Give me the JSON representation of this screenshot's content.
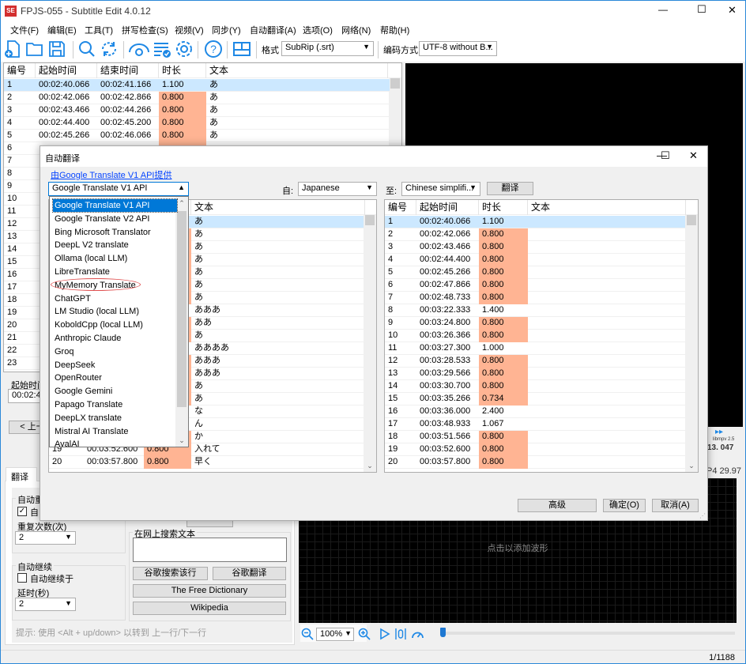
{
  "window": {
    "title": "FPJS-055 - Subtitle Edit 4.0.12",
    "app_icon_text": "SE",
    "minimize": "—",
    "maximize": "☐",
    "close": "✕"
  },
  "menu": [
    "文件(F)",
    "编辑(E)",
    "工具(T)",
    "拼写检查(S)",
    "视频(V)",
    "同步(Y)",
    "自动翻译(A)",
    "选项(O)",
    "网络(N)",
    "帮助(H)"
  ],
  "toolbar": {
    "icons": [
      "new-file-icon",
      "open-folder-icon",
      "save-icon",
      "find-icon",
      "replace-icon",
      "visual-sync-icon",
      "spell-check-icon",
      "settings-icon",
      "help-icon",
      "layout-icon"
    ],
    "format_label": "格式",
    "format_value": "SubRip (.srt)",
    "encoding_label": "编码方式",
    "encoding_value": "UTF-8 without B..."
  },
  "main_grid": {
    "headers": [
      "编号",
      "起始时间",
      "结束时间",
      "时长",
      "文本"
    ],
    "rows": [
      {
        "num": "1",
        "start": "00:02:40.066",
        "end": "00:02:41.166",
        "dur": "1.100",
        "text": "あ"
      },
      {
        "num": "2",
        "start": "00:02:42.066",
        "end": "00:02:42.866",
        "dur": "0.800",
        "text": "あ"
      },
      {
        "num": "3",
        "start": "00:02:43.466",
        "end": "00:02:44.266",
        "dur": "0.800",
        "text": "あ"
      },
      {
        "num": "4",
        "start": "00:02:44.400",
        "end": "00:02:45.200",
        "dur": "0.800",
        "text": "あ"
      },
      {
        "num": "5",
        "start": "00:02:45.266",
        "end": "00:02:46.066",
        "dur": "0.800",
        "text": "あ"
      },
      {
        "num": "6"
      },
      {
        "num": "7"
      },
      {
        "num": "8"
      },
      {
        "num": "9"
      },
      {
        "num": "10"
      },
      {
        "num": "11"
      },
      {
        "num": "12"
      },
      {
        "num": "13"
      },
      {
        "num": "14"
      },
      {
        "num": "15"
      },
      {
        "num": "16"
      },
      {
        "num": "17"
      },
      {
        "num": "18"
      },
      {
        "num": "19"
      },
      {
        "num": "20"
      },
      {
        "num": "21"
      },
      {
        "num": "22"
      },
      {
        "num": "23"
      }
    ]
  },
  "edit_panel": {
    "start_label": "起始时间",
    "start_value": "00:02:40",
    "prev_button": "< 上一"
  },
  "bottom_panel": {
    "tab": "翻译",
    "auto_repeat_label": "自动重",
    "auto_repeat_checkbox": "自",
    "repeat_count_label": "重复次数(次)",
    "repeat_count_value": "2",
    "auto_continue_label": "自动继续",
    "auto_continue_checkbox": "自动继续于",
    "delay_label": "延时(秒)",
    "delay_value": "2",
    "search_group_label": "在网上搜索文本",
    "search_text": "",
    "google_search_button": "谷歌搜索该行",
    "google_translate_button": "谷歌翻译",
    "free_dictionary_button": "The Free Dictionary",
    "wikipedia_button": "Wikipedia",
    "hint": "提示: 使用 <Alt + up/down> 以转到 上一行/下一行"
  },
  "video": {
    "player_info": "libmpv 2.5",
    "time": "13. 047",
    "format_info": "P4 29.97"
  },
  "waveform": {
    "placeholder": "点击以添加波形",
    "zoom_value": "100%"
  },
  "status": {
    "position": "1/1188"
  },
  "dialog": {
    "title": "自动翻译",
    "powered_by_link": "由Google Translate V1 API提供",
    "engine_value": "Google Translate V1 API",
    "engines": [
      "Google Translate V1 API",
      "Google Translate V2 API",
      "Bing Microsoft Translator",
      "DeepL V2 translate",
      "Ollama (local LLM)",
      "LibreTranslate",
      "MyMemory Translate",
      "ChatGPT",
      "LM Studio (local LLM)",
      "KoboldCpp (local LLM)",
      "Anthropic Claude",
      "Groq",
      "DeepSeek",
      "OpenRouter",
      "Google Gemini",
      "Papago Translate",
      "DeepLX translate",
      "Mistral AI Translate",
      "AvalAI"
    ],
    "highlighted_engine": "MyMemory Translate",
    "annotation_color": "#e05050",
    "from_label": "自:",
    "from_value": "Japanese",
    "to_label": "至:",
    "to_value": "Chinese simplifi...",
    "translate_button": "翻译",
    "source_headers": [
      "文本"
    ],
    "target_headers": [
      "编号",
      "起始时间",
      "时长",
      "文本"
    ],
    "rows": [
      {
        "num": "1",
        "start": "00:02:40.066",
        "dur": "1.100",
        "text": "あ"
      },
      {
        "num": "2",
        "start": "00:02:42.066",
        "dur": "0.800",
        "text": "あ"
      },
      {
        "num": "3",
        "start": "00:02:43.466",
        "dur": "0.800",
        "text": "あ"
      },
      {
        "num": "4",
        "start": "00:02:44.400",
        "dur": "0.800",
        "text": "あ"
      },
      {
        "num": "5",
        "start": "00:02:45.266",
        "dur": "0.800",
        "text": "あ"
      },
      {
        "num": "6",
        "start": "00:02:47.866",
        "dur": "0.800",
        "text": "あ"
      },
      {
        "num": "7",
        "start": "00:02:48.733",
        "dur": "0.800",
        "text": "あ"
      },
      {
        "num": "8",
        "start": "00:03:22.333",
        "dur": "1.400",
        "text": "あああ"
      },
      {
        "num": "9",
        "start": "00:03:24.800",
        "dur": "0.800",
        "text": "ああ"
      },
      {
        "num": "10",
        "start": "00:03:26.366",
        "dur": "0.800",
        "text": "あ"
      },
      {
        "num": "11",
        "start": "00:03:27.300",
        "dur": "1.000",
        "text": "ああああ"
      },
      {
        "num": "12",
        "start": "00:03:28.533",
        "dur": "0.800",
        "text": "あああ"
      },
      {
        "num": "13",
        "start": "00:03:29.566",
        "dur": "0.800",
        "text": "あああ"
      },
      {
        "num": "14",
        "start": "00:03:30.700",
        "dur": "0.800",
        "text": "あ"
      },
      {
        "num": "15",
        "start": "00:03:35.266",
        "dur": "0.734",
        "text": "あ"
      },
      {
        "num": "16",
        "start": "00:03:36.000",
        "dur": "2.400",
        "text": "な"
      },
      {
        "num": "17",
        "start": "00:03:48.933",
        "dur": "1.067",
        "text": "ん"
      },
      {
        "num": "18",
        "start": "00:03:51.566",
        "dur": "0.800",
        "text": "か"
      },
      {
        "num": "19",
        "start": "00:03:52.600",
        "dur": "0.800",
        "text": "入れて"
      },
      {
        "num": "20",
        "start": "00:03:57.800",
        "dur": "0.800",
        "text": "早く"
      }
    ],
    "advanced_button": "高级",
    "ok_button": "确定(O)",
    "cancel_button": "取消(A)"
  },
  "colors": {
    "accent": "#0078d7",
    "short_duration": "#ffb493",
    "selected_row": "#cce8ff",
    "link": "#0645ff"
  }
}
